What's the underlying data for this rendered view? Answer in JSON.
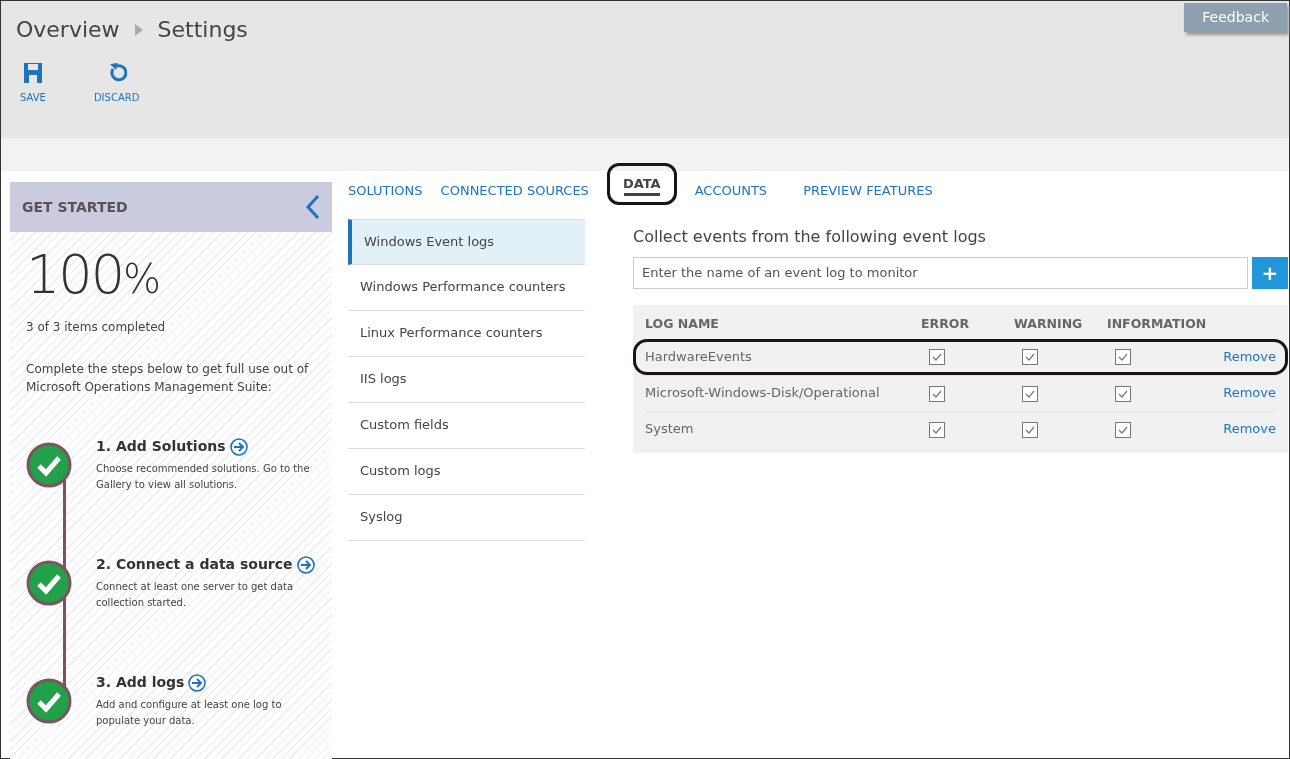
{
  "breadcrumb": [
    "Overview",
    "Settings"
  ],
  "feedback": "Feedback",
  "toolbar": [
    {
      "kind": "save",
      "label": "SAVE"
    },
    {
      "kind": "discard",
      "label": "DISCARD"
    }
  ],
  "get_started": {
    "title": "GET STARTED",
    "percent": "100",
    "percent_sign": "%",
    "completed": "3 of 3 items completed",
    "intro": "Complete the steps below to get full use out of Microsoft Operations Management Suite:",
    "steps": [
      {
        "title": "1. Add Solutions",
        "text": "Choose recommended solutions. Go to the Gallery to view all solutions.",
        "done": true
      },
      {
        "title": "2. Connect a data source",
        "text": "Connect at least one server to get data collection started.",
        "done": true
      },
      {
        "title": "3. Add logs",
        "text": "Add and configure at least one log to populate your data.",
        "done": true
      }
    ]
  },
  "tabs": [
    {
      "label": "SOLUTIONS",
      "selected": false,
      "highlighted": false
    },
    {
      "label": "CONNECTED SOURCES",
      "selected": false,
      "highlighted": false
    },
    {
      "label": "DATA",
      "selected": true,
      "highlighted": true
    },
    {
      "label": "ACCOUNTS",
      "selected": false,
      "highlighted": false
    },
    {
      "label": "PREVIEW FEATURES",
      "selected": false,
      "highlighted": false
    }
  ],
  "data_nav": [
    {
      "label": "Windows Event logs",
      "selected": true
    },
    {
      "label": "Windows Performance counters",
      "selected": false
    },
    {
      "label": "Linux Performance counters",
      "selected": false
    },
    {
      "label": "IIS logs",
      "selected": false
    },
    {
      "label": "Custom fields",
      "selected": false
    },
    {
      "label": "Custom logs",
      "selected": false
    },
    {
      "label": "Syslog",
      "selected": false
    }
  ],
  "event_logs": {
    "heading": "Collect events from the following event logs",
    "placeholder": "Enter the name of an event log to monitor",
    "add_button": "+",
    "columns": [
      "LOG NAME",
      "ERROR",
      "WARNING",
      "INFORMATION"
    ],
    "rows": [
      {
        "name": "HardwareEvents",
        "error": true,
        "warning": true,
        "information": true,
        "action": "Remove",
        "highlighted": true
      },
      {
        "name": "Microsoft-Windows-Disk/Operational",
        "error": true,
        "warning": true,
        "information": true,
        "action": "Remove",
        "highlighted": false
      },
      {
        "name": "System",
        "error": true,
        "warning": true,
        "information": true,
        "action": "Remove",
        "highlighted": false
      }
    ]
  }
}
